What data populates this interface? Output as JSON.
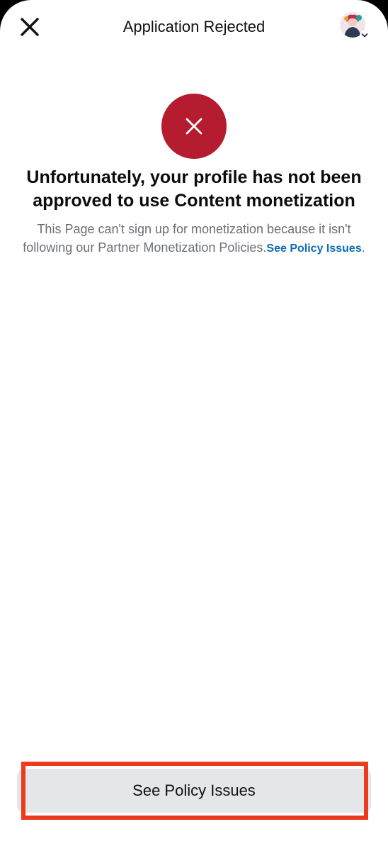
{
  "header": {
    "title": "Application Rejected",
    "close_icon": "close-icon",
    "avatar_icon": "profile-avatar",
    "chevron_icon": "chevron-down-icon"
  },
  "status": {
    "icon": "x-icon",
    "color": "#b61c2f"
  },
  "main": {
    "headline": "Unfortunately, your profile has not been approved to use Content monetization",
    "description": "This Page can't sign up for monetization because it isn't following our Partner Monetization Policies.",
    "link_text": "See Policy Issues",
    "trailing": "."
  },
  "footer": {
    "button_label": "See Policy Issues",
    "highlight_color": "#ee3a1c"
  },
  "colors": {
    "link": "#0d6bb8",
    "button_bg": "#e5e6e8"
  }
}
